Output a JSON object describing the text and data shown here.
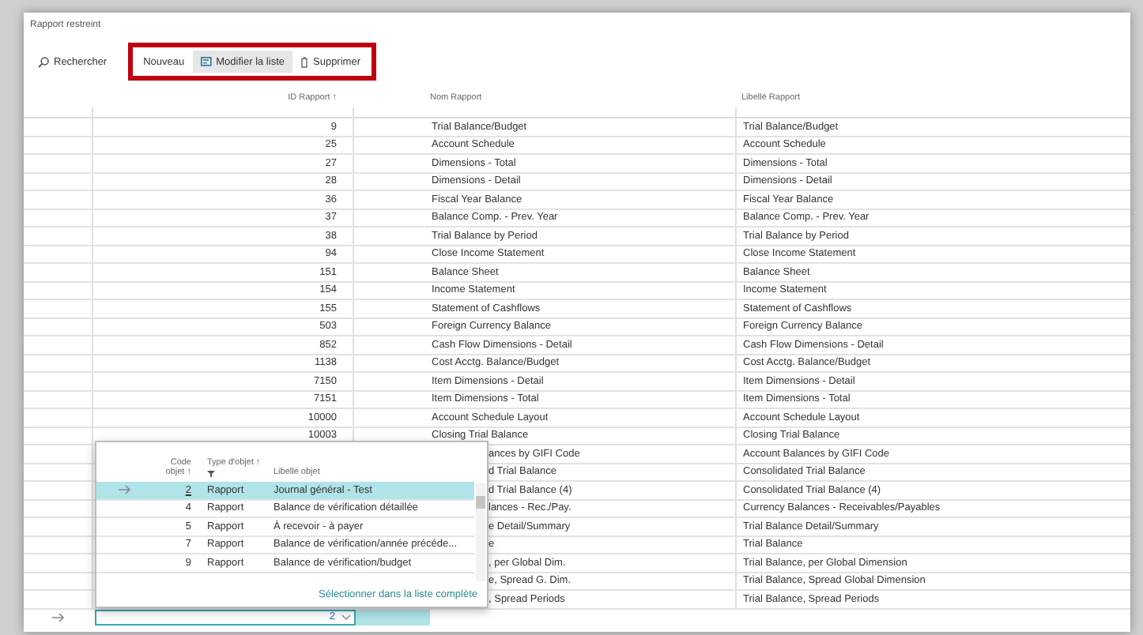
{
  "window": {
    "title": "Rapport restreint"
  },
  "toolbar": {
    "search": "Rechercher",
    "actions": [
      {
        "label": "Nouveau",
        "kind": "plain",
        "selected": false
      },
      {
        "label": "Modifier la liste",
        "kind": "edit",
        "selected": true
      },
      {
        "label": "Supprimer",
        "kind": "delete",
        "selected": false
      }
    ]
  },
  "table": {
    "columns": [
      "ID Rapport ↑",
      "Nom Rapport",
      "Libellé Rapport"
    ],
    "rows": [
      {
        "id": "9",
        "name": "Trial Balance/Budget",
        "caption": "Trial Balance/Budget"
      },
      {
        "id": "25",
        "name": "Account Schedule",
        "caption": "Account Schedule"
      },
      {
        "id": "27",
        "name": "Dimensions - Total",
        "caption": "Dimensions - Total"
      },
      {
        "id": "28",
        "name": "Dimensions - Detail",
        "caption": "Dimensions - Detail"
      },
      {
        "id": "36",
        "name": "Fiscal Year Balance",
        "caption": "Fiscal Year Balance"
      },
      {
        "id": "37",
        "name": "Balance Comp. - Prev. Year",
        "caption": "Balance Comp. - Prev. Year"
      },
      {
        "id": "38",
        "name": "Trial Balance by Period",
        "caption": "Trial Balance by Period"
      },
      {
        "id": "94",
        "name": "Close Income Statement",
        "caption": "Close Income Statement"
      },
      {
        "id": "151",
        "name": "Balance Sheet",
        "caption": "Balance Sheet"
      },
      {
        "id": "154",
        "name": "Income Statement",
        "caption": "Income Statement"
      },
      {
        "id": "155",
        "name": "Statement of Cashflows",
        "caption": "Statement of Cashflows"
      },
      {
        "id": "503",
        "name": "Foreign Currency Balance",
        "caption": "Foreign Currency Balance"
      },
      {
        "id": "852",
        "name": "Cash Flow Dimensions - Detail",
        "caption": "Cash Flow Dimensions - Detail"
      },
      {
        "id": "1138",
        "name": "Cost Acctg. Balance/Budget",
        "caption": "Cost Acctg. Balance/Budget"
      },
      {
        "id": "7150",
        "name": "Item Dimensions - Detail",
        "caption": "Item Dimensions - Detail"
      },
      {
        "id": "7151",
        "name": "Item Dimensions - Total",
        "caption": "Item Dimensions - Total"
      },
      {
        "id": "10000",
        "name": "Account Schedule Layout",
        "caption": "Account Schedule Layout"
      },
      {
        "id": "10003",
        "name": "Closing Trial Balance",
        "caption": "Closing Trial Balance"
      },
      {
        "name": "ances by GIFI Code",
        "caption": "Account Balances by GIFI Code"
      },
      {
        "name": "d Trial Balance",
        "caption": "Consolidated Trial Balance"
      },
      {
        "name": "d Trial Balance (4)",
        "caption": "Consolidated Trial Balance (4)"
      },
      {
        "name": "lances - Rec./Pay.",
        "caption": "Currency Balances - Receivables/Payables"
      },
      {
        "name": "e Detail/Summary",
        "caption": "Trial Balance Detail/Summary"
      },
      {
        "name": "e",
        "caption": "Trial Balance"
      },
      {
        "name": ", per Global Dim.",
        "caption": "Trial Balance, per Global Dimension"
      },
      {
        "name": "e, Spread G. Dim.",
        "caption": "Trial Balance, Spread Global Dimension"
      },
      {
        "name": ", Spread Periods",
        "caption": "Trial Balance, Spread Periods"
      }
    ]
  },
  "entry": {
    "value": "2"
  },
  "lookup": {
    "columns": [
      "Code objet ↑",
      "Type d'objet ↑",
      "Libellé objet"
    ],
    "rows": [
      {
        "code": "2",
        "type": "Rapport",
        "caption": "Journal général - Test",
        "selected": true
      },
      {
        "code": "4",
        "type": "Rapport",
        "caption": "Balance de vérification détaillée",
        "selected": false
      },
      {
        "code": "5",
        "type": "Rapport",
        "caption": "À recevoir - à payer",
        "selected": false
      },
      {
        "code": "7",
        "type": "Rapport",
        "caption": "Balance de vérification/année précéde...",
        "selected": false
      },
      {
        "code": "9",
        "type": "Rapport",
        "caption": "Balance de vérification/budget",
        "selected": false
      }
    ],
    "footer_link": "Sélectionner dans la liste complète"
  }
}
